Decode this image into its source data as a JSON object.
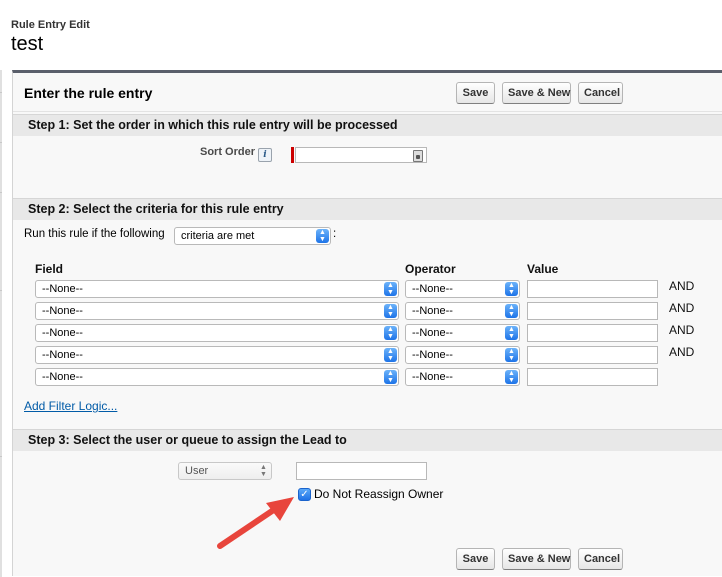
{
  "page": {
    "breadcrumb": "Rule Entry Edit",
    "title": "test"
  },
  "header": {
    "title": "Enter the rule entry"
  },
  "buttons": {
    "save": "Save",
    "save_new": "Save & New",
    "cancel": "Cancel"
  },
  "step1": {
    "title": "Step 1: Set the order in which this rule entry will be processed",
    "sort_order_label": "Sort Order",
    "info_icon": "i",
    "sort_order_value": ""
  },
  "step2": {
    "title": "Step 2: Select the criteria for this rule entry",
    "run_rule_label": "Run this rule if the following",
    "criteria_selected": "criteria are met",
    "colon": ":",
    "columns": {
      "field": "Field",
      "operator": "Operator",
      "value": "Value"
    },
    "rows": [
      {
        "field": "--None--",
        "operator": "--None--",
        "value": "",
        "conj": "AND"
      },
      {
        "field": "--None--",
        "operator": "--None--",
        "value": "",
        "conj": "AND"
      },
      {
        "field": "--None--",
        "operator": "--None--",
        "value": "",
        "conj": "AND"
      },
      {
        "field": "--None--",
        "operator": "--None--",
        "value": "",
        "conj": "AND"
      },
      {
        "field": "--None--",
        "operator": "--None--",
        "value": "",
        "conj": ""
      }
    ],
    "add_filter_logic": "Add Filter Logic..."
  },
  "step3": {
    "title": "Step 3: Select the user or queue to assign the Lead to",
    "assign_type": "User",
    "assignee_value": "",
    "do_not_reassign_label": "Do Not Reassign Owner",
    "do_not_reassign_checked": true
  },
  "annotation": {
    "arrow_color": "#e8453c"
  },
  "colors": {
    "header_accent": "#5a5f6b",
    "link": "#015ba7",
    "required": "#cc0000",
    "select_arrow": "#1e74e8"
  },
  "icons": {
    "select_arrow": "up-down-chevron-icon",
    "lock": "lookup-icon",
    "check": "checkmark-icon"
  }
}
